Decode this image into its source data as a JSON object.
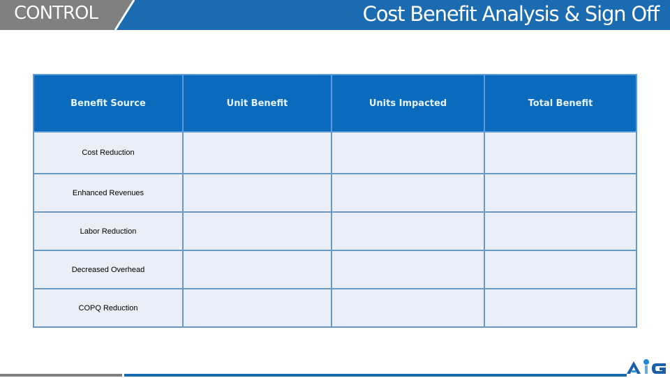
{
  "header": {
    "section_label": "CONTROL",
    "title": "Cost Benefit Analysis & Sign Off",
    "colors": {
      "gray": "#808080",
      "blue": "#1a6bb0"
    }
  },
  "table": {
    "columns": [
      "Benefit Source",
      "Unit Benefit",
      "Units Impacted",
      "Total Benefit"
    ],
    "rows": [
      {
        "source": "Cost Reduction",
        "unit_benefit": "",
        "units_impacted": "",
        "total_benefit": ""
      },
      {
        "source": "Enhanced Revenues",
        "unit_benefit": "",
        "units_impacted": "",
        "total_benefit": ""
      },
      {
        "source": "Labor Reduction",
        "unit_benefit": "",
        "units_impacted": "",
        "total_benefit": ""
      },
      {
        "source": "Decreased Overhead",
        "unit_benefit": "",
        "units_impacted": "",
        "total_benefit": ""
      },
      {
        "source": "COPQ Reduction",
        "unit_benefit": "",
        "units_impacted": "",
        "total_benefit": ""
      }
    ],
    "colors": {
      "header_bg": "#0a6bbd",
      "cell_bg": "#e9eef7",
      "border": "#6a9ac4"
    }
  },
  "logo": {
    "text": "AIG",
    "icon": "company-logo-icon"
  }
}
